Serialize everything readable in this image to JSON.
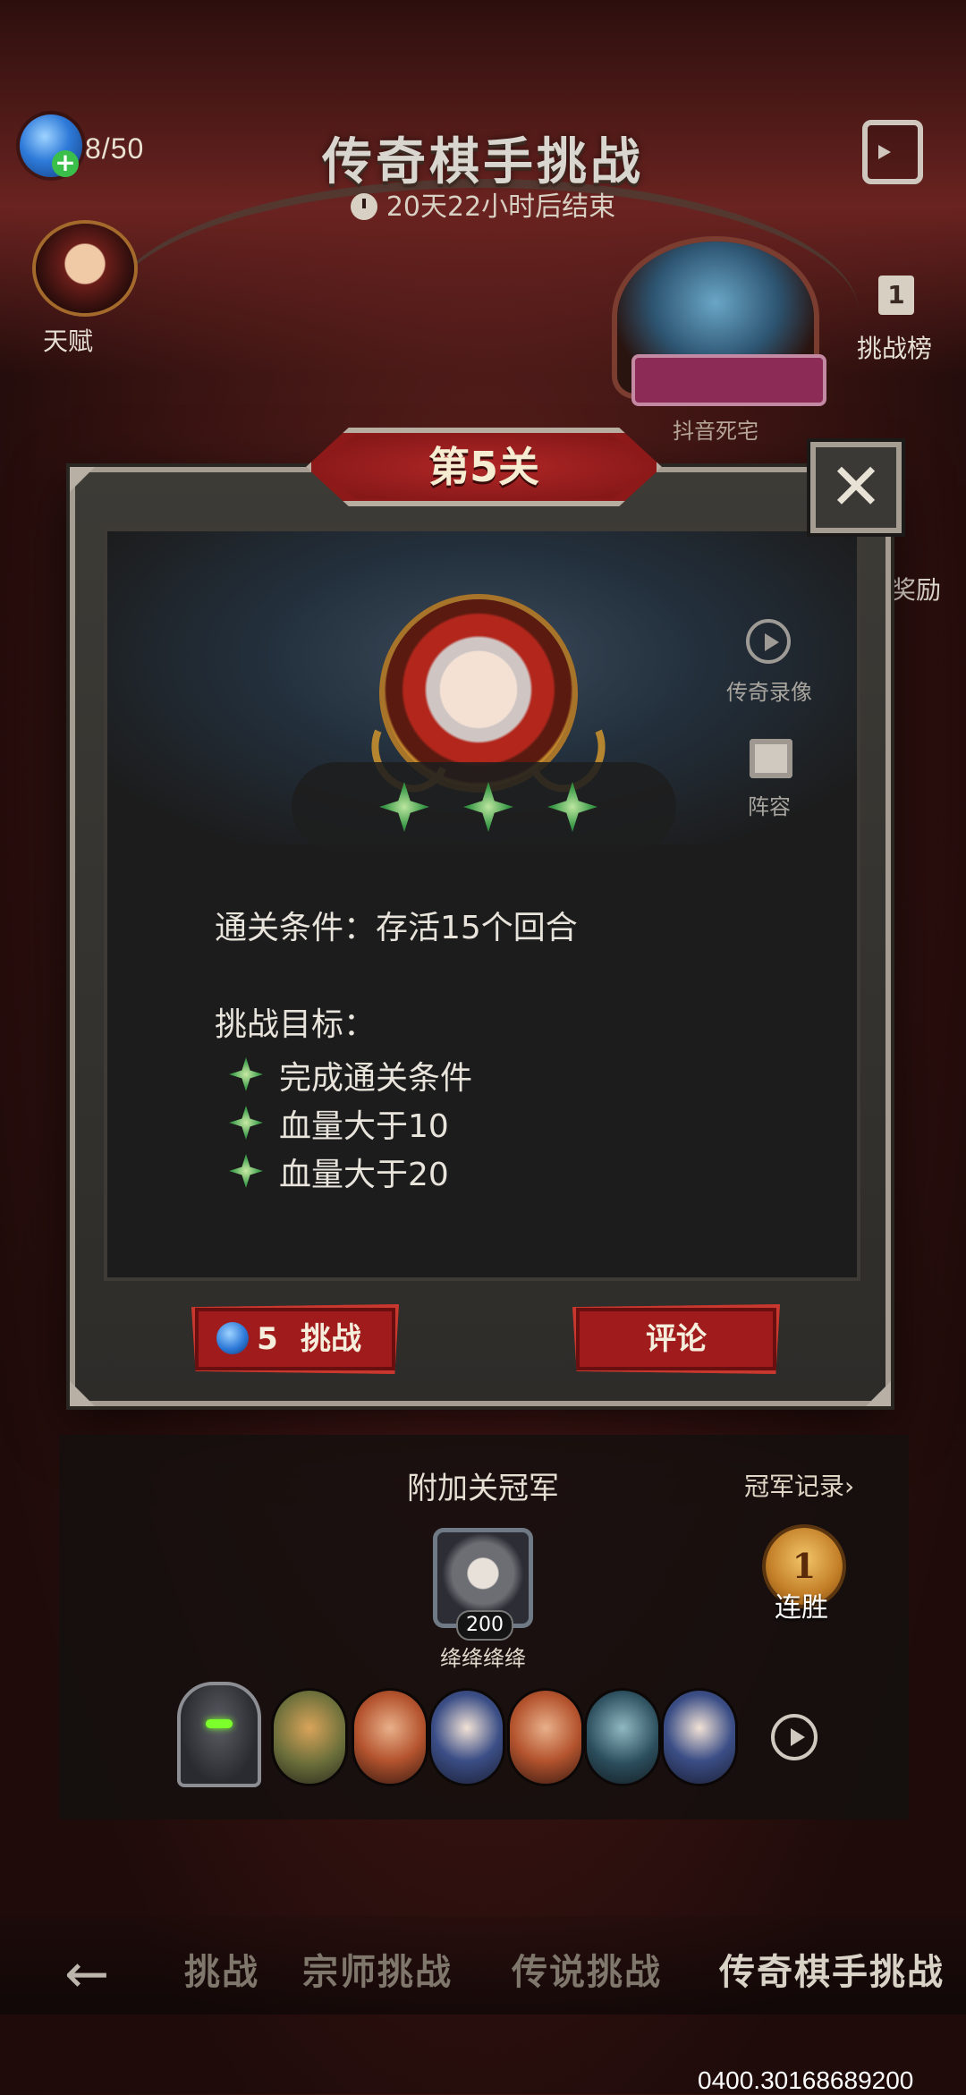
{
  "header": {
    "energy": "8/50",
    "title": "传奇棋手挑战",
    "timer": "20天22小时后结束"
  },
  "side": {
    "talent_label": "天赋",
    "rank_number": "1",
    "rank_label": "挑战榜",
    "boss_name": "抖音死宅",
    "reward_label": "奖励"
  },
  "modal": {
    "stage_title": "第5关",
    "close_glyph": "✕",
    "replay_label": "传奇录像",
    "lineup_label": "阵容",
    "clear_condition": "通关条件：存活15个回合",
    "goal_title": "挑战目标：",
    "goals": [
      "完成通关条件",
      "血量大于10",
      "血量大于20"
    ],
    "challenge_cost": "5",
    "challenge_label": "挑战",
    "comment_label": "评论",
    "stars_earned": 3
  },
  "champion": {
    "title": "附加关冠军",
    "record_link": "冠军记录›",
    "level": "200",
    "name": "绛绛绛绛",
    "win_streak": "1",
    "win_label": "连胜"
  },
  "tabs": {
    "back_glyph": "←",
    "items": [
      "挑战",
      "宗师挑战",
      "传说挑战",
      "传奇棋手挑战"
    ],
    "active": "传奇棋手挑战"
  },
  "watermark": "0400.30168689200",
  "colors": {
    "accent_red": "#a01c1c",
    "star_green": "#3a9a48",
    "panel_border": "#a59d92"
  }
}
